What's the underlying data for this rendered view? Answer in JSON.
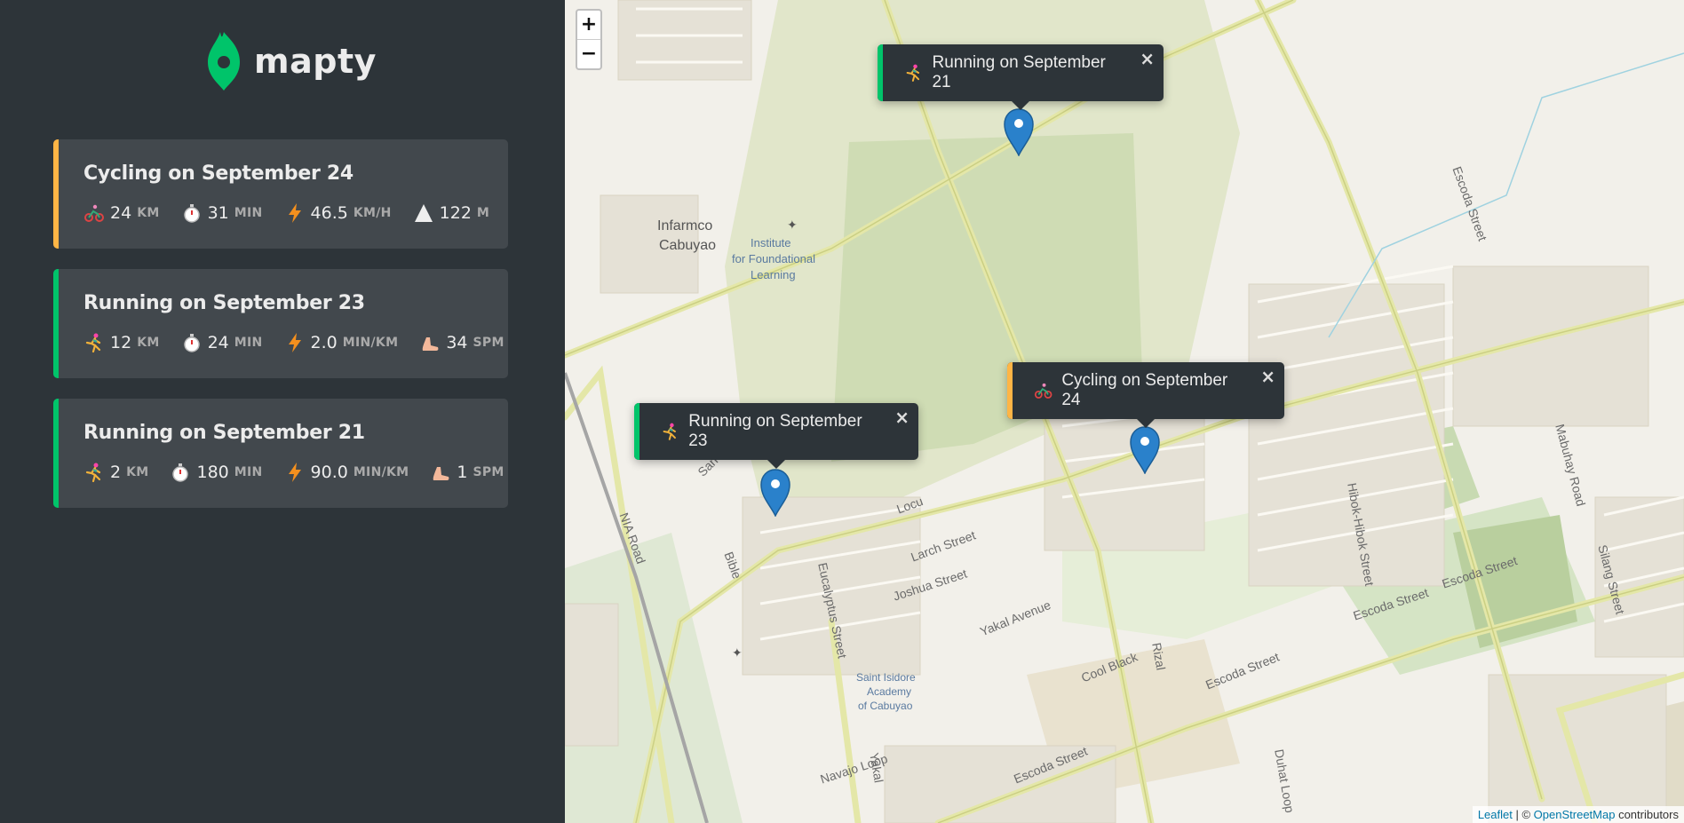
{
  "app": {
    "logo_text": "mapty"
  },
  "colors": {
    "running": "#00c46a",
    "cycling": "#ffb545",
    "sidebar_bg": "#2d3439",
    "card_bg": "#42484d",
    "marker": "#2a81cb"
  },
  "workouts": [
    {
      "type": "cycling",
      "title": "Cycling on September 24",
      "details": [
        {
          "icon": "cyclist-icon",
          "value": "24",
          "unit": "km"
        },
        {
          "icon": "stopwatch-icon",
          "value": "31",
          "unit": "min"
        },
        {
          "icon": "lightning-icon",
          "value": "46.5",
          "unit": "km/h"
        },
        {
          "icon": "mountain-icon",
          "value": "122",
          "unit": "m"
        }
      ]
    },
    {
      "type": "running",
      "title": "Running on September 23",
      "details": [
        {
          "icon": "runner-icon",
          "value": "12",
          "unit": "km"
        },
        {
          "icon": "stopwatch-icon",
          "value": "24",
          "unit": "min"
        },
        {
          "icon": "lightning-icon",
          "value": "2.0",
          "unit": "min/km"
        },
        {
          "icon": "footprint-icon",
          "value": "34",
          "unit": "spm"
        }
      ]
    },
    {
      "type": "running",
      "title": "Running on September 21",
      "details": [
        {
          "icon": "runner-icon",
          "value": "2",
          "unit": "km"
        },
        {
          "icon": "stopwatch-icon",
          "value": "180",
          "unit": "min"
        },
        {
          "icon": "lightning-icon",
          "value": "90.0",
          "unit": "min/km"
        },
        {
          "icon": "footprint-icon",
          "value": "1",
          "unit": "spm"
        }
      ]
    }
  ],
  "map": {
    "zoom_in": "+",
    "zoom_out": "−",
    "popups": [
      {
        "type": "running",
        "text": "Running on September 21",
        "close": "×"
      },
      {
        "type": "cycling",
        "text": "Cycling on September 24",
        "close": "×"
      },
      {
        "type": "running",
        "text": "Running on September 23",
        "close": "×"
      }
    ],
    "labels": {
      "infarmco": "Infarmco",
      "cabuyao": "Cabuyao",
      "institute1": "Institute",
      "institute2": "for Foundational",
      "institute3": "Learning",
      "escoda_street_1": "Escoda Street",
      "escoda_street_2": "Escoda Street",
      "escoda_street_3": "Escoda Street",
      "escoda_street_4": "Escoda Street",
      "escoda_street_5": "Escoda Street",
      "mabuhay_road": "Mabuhay Road",
      "hibok_street": "Hibok-Hibok Street",
      "silang_street": "Silang Street",
      "nia_road": "NIA Road",
      "bible": "Bible",
      "san": "San",
      "locu": "Locu",
      "larch_street": "Larch Street",
      "joshua_street": "Joshua Street",
      "eucalyptus_street": "Eucalyptus Street",
      "yakal_avenue": "Yakal Avenue",
      "rizal": "Rizal",
      "cool_black": "Cool Black",
      "duhat_loop": "Duhat Loop",
      "navajo_loop": "Navajo Loop",
      "yakal": "Yakal",
      "saint1": "Saint Isidore",
      "saint2": "Academy",
      "saint3": "of Cabuyao"
    },
    "attribution": {
      "leaflet": "Leaflet",
      "sep": " | © ",
      "osm": "OpenStreetMap",
      "contrib": " contributors"
    }
  }
}
